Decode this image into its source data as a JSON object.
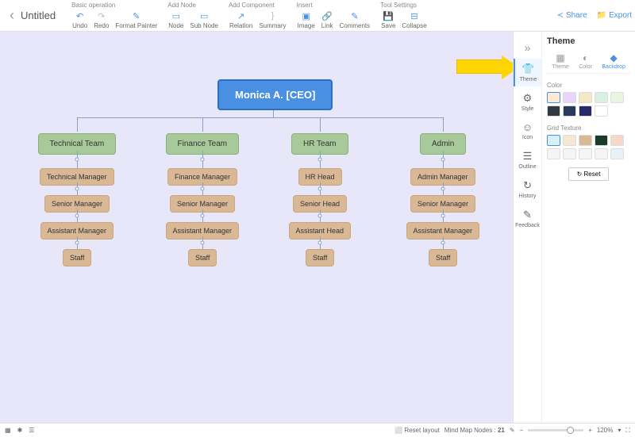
{
  "doc": {
    "title": "Untitled"
  },
  "toolbar": {
    "groups": {
      "basic": {
        "label": "Basic operation",
        "undo": "Undo",
        "redo": "Redo",
        "fp": "Format Painter"
      },
      "addnode": {
        "label": "Add Node",
        "node": "Node",
        "sub": "Sub Node"
      },
      "addcomp": {
        "label": "Add Component",
        "rel": "Relation",
        "sum": "Summary"
      },
      "insert": {
        "label": "Insert",
        "img": "Image",
        "link": "Link",
        "com": "Comments"
      },
      "tools": {
        "label": "Tool Settings",
        "save": "Save",
        "col": "Collapse"
      }
    },
    "share": "Share",
    "export": "Export"
  },
  "org": {
    "ceo": "Monica A. [CEO]",
    "cols": [
      {
        "team": "Technical Team",
        "n1": "Technical Manager",
        "n2": "Senior Manager",
        "n3": "Assistant Manager",
        "n4": "Staff"
      },
      {
        "team": "Finance Team",
        "n1": "Finance Manager",
        "n2": "Senior Manager",
        "n3": "Assistant Manager",
        "n4": "Staff"
      },
      {
        "team": "HR Team",
        "n1": "HR Head",
        "n2": "Senior Head",
        "n3": "Assistant Head",
        "n4": "Staff"
      },
      {
        "team": "Admin",
        "n1": "Admin Manager",
        "n2": "Senior Manager",
        "n3": "Assistant Manager",
        "n4": "Staff"
      }
    ]
  },
  "rail": {
    "theme": "Theme",
    "style": "Style",
    "icon": "Icon",
    "outline": "Outline",
    "history": "History",
    "feedback": "Feedback"
  },
  "panel": {
    "title": "Theme",
    "tabs": {
      "theme": "Theme",
      "color": "Color",
      "backdrop": "Backdrop"
    },
    "colorLabel": "Color",
    "textureLabel": "Grid Texture",
    "reset": "Reset",
    "colors": [
      "#fde8d4",
      "#e8d4fd",
      "#f5e8c4",
      "#d8f0e0",
      "#e8f5e0",
      "#333944",
      "#2a3a5a",
      "#2a2a6a",
      "#ffffff"
    ],
    "textures": [
      "#d8f0f5",
      "#f5e8d0",
      "#d9b896",
      "#1a3a2a",
      "#f5d8c8",
      "#f5f5f5",
      "#f5f5f5",
      "#f5f5f5",
      "#f5f5f5",
      "#e8f0f8"
    ]
  },
  "status": {
    "reset": "Reset layout",
    "nodesLabel": "Mind Map Nodes :",
    "nodes": "21",
    "zoom": "120%"
  }
}
